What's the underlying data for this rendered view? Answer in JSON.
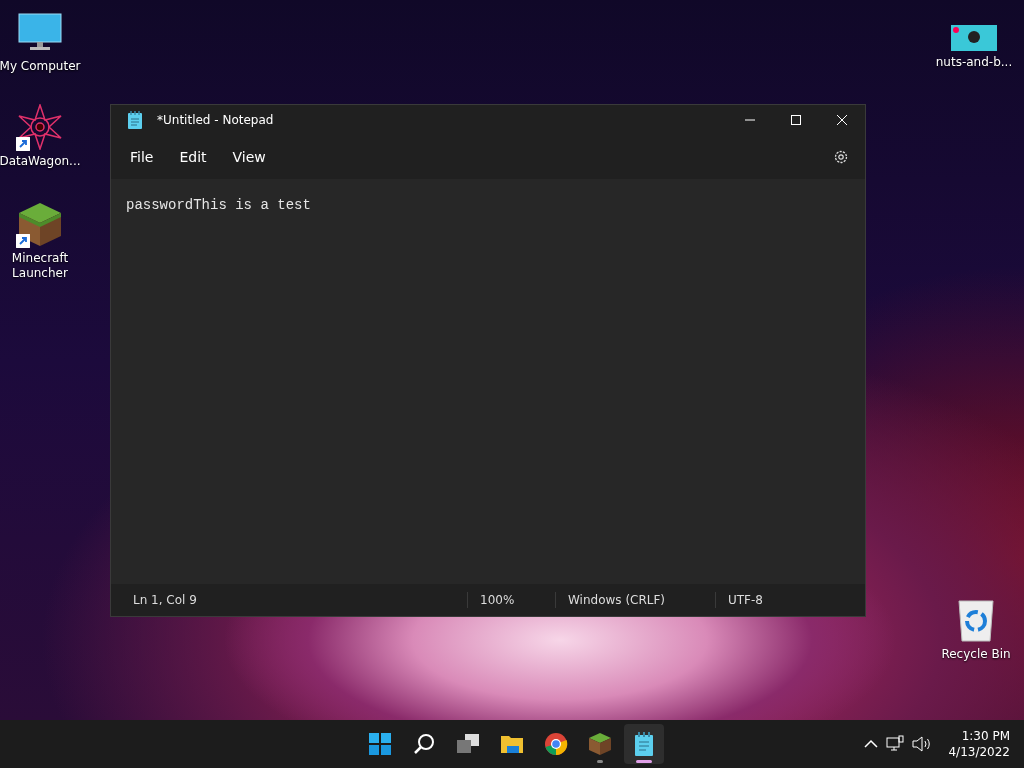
{
  "desktop_icons": [
    {
      "kind": "computer",
      "label": "My Computer",
      "shortcut": false
    },
    {
      "kind": "star",
      "label": "DataWagon...",
      "shortcut": true
    },
    {
      "kind": "block",
      "label": "Minecraft Launcher",
      "shortcut": true
    },
    {
      "kind": "thumbnail",
      "label": "nuts-and-b...",
      "shortcut": false
    },
    {
      "kind": "bin",
      "label": "Recycle Bin",
      "shortcut": false
    }
  ],
  "window": {
    "title": "*Untitled - Notepad",
    "menu": [
      "File",
      "Edit",
      "View"
    ],
    "text": "passwordThis is a test",
    "status_bar": [
      "Ln 1, Col 9",
      "100%",
      "Windows (CRLF)",
      "UTF-8"
    ]
  },
  "taskbar": {
    "apps": [
      {
        "kind": "start",
        "running": false,
        "selected": false
      },
      {
        "kind": "search",
        "running": false,
        "selected": false
      },
      {
        "kind": "taskview",
        "running": false,
        "selected": false
      },
      {
        "kind": "folder",
        "running": false,
        "selected": false
      },
      {
        "kind": "browser",
        "running": false,
        "selected": false
      },
      {
        "kind": "block",
        "running": true,
        "selected": false
      },
      {
        "kind": "notepad",
        "running": true,
        "selected": true
      }
    ],
    "time": "1:30 PM",
    "date": "4/13/2022"
  }
}
